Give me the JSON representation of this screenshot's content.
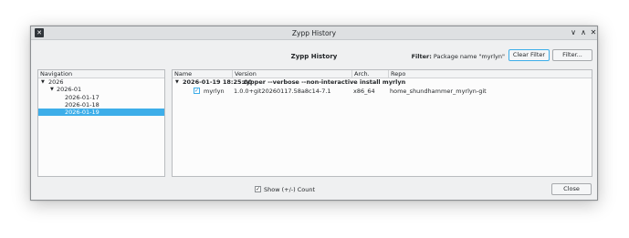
{
  "window": {
    "title": "Zypp History",
    "app_icon": "terminal-x-icon"
  },
  "controls": {
    "minimize": "∨",
    "maximize": "∧",
    "close": "✕"
  },
  "header": {
    "heading": "Zypp History",
    "filter_label": "Filter:",
    "filter_value": "Package name \"myrlyn\"",
    "clear_filter": "Clear Filter",
    "filter_button": "Filter..."
  },
  "navigation": {
    "title": "Navigation",
    "items": [
      {
        "label": "2026",
        "level": 0,
        "expanded": true
      },
      {
        "label": "2026-01",
        "level": 1,
        "expanded": true
      },
      {
        "label": "2026-01-17",
        "level": 2
      },
      {
        "label": "2026-01-18",
        "level": 2
      },
      {
        "label": "2026-01-19",
        "level": 2,
        "selected": true
      }
    ]
  },
  "history": {
    "columns": [
      "Name",
      "Version",
      "Arch.",
      "Repo"
    ],
    "command_row": {
      "timestamp": "2026-01-19 18:25:00",
      "command": "zypper --verbose --non-interactive install myrlyn"
    },
    "package_row": {
      "name": "myrlyn",
      "version": "1.0.0+git20260117.58a8c14-7.1",
      "arch": "x86_64",
      "repo": "home_shundhammer_myrlyn-git",
      "status_icon": "installed-check-icon"
    }
  },
  "footer": {
    "show_count_label": "Show (+/-) Count",
    "show_count_checked": true,
    "close_label": "Close"
  }
}
